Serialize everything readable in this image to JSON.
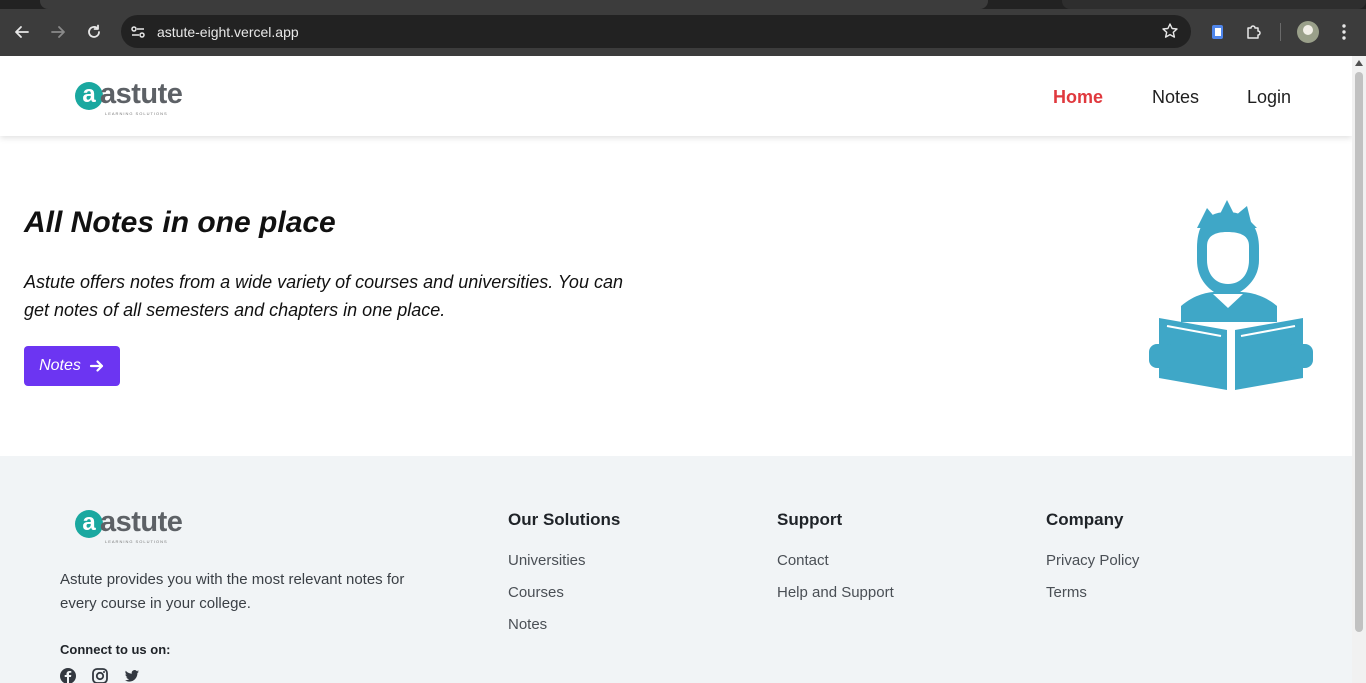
{
  "browser": {
    "url": "astute-eight.vercel.app"
  },
  "header": {
    "logo_text": "astute",
    "logo_tagline": "LEARNING SOLUTIONS",
    "nav": [
      {
        "label": "Home",
        "active": true
      },
      {
        "label": "Notes",
        "active": false
      },
      {
        "label": "Login",
        "active": false
      }
    ]
  },
  "hero": {
    "title_pre": "All ",
    "title_bold": "Notes",
    "title_post": " in one place",
    "description": "Astute offers notes from a wide variety of courses and universities. You can get notes of all semesters and chapters in one place.",
    "button_label": "Notes",
    "illustration_icon": "reader-icon"
  },
  "footer": {
    "logo_text": "astute",
    "logo_tagline": "LEARNING SOLUTIONS",
    "description": "Astute provides you with the most relevant notes for every course in your college.",
    "connect_label": "Connect to us on:",
    "social": [
      "facebook-icon",
      "instagram-icon",
      "twitter-icon"
    ],
    "columns": [
      {
        "title": "Our Solutions",
        "links": [
          "Universities",
          "Courses",
          "Notes"
        ]
      },
      {
        "title": "Support",
        "links": [
          "Contact",
          "Help and Support"
        ]
      },
      {
        "title": "Company",
        "links": [
          "Privacy Policy",
          "Terms"
        ]
      }
    ]
  },
  "colors": {
    "accent_button": "#6c35f2",
    "nav_active": "#e0393e",
    "logo_teal": "#1aa8a0",
    "illustration": "#3fa7c7",
    "footer_bg": "#f1f4f6"
  }
}
